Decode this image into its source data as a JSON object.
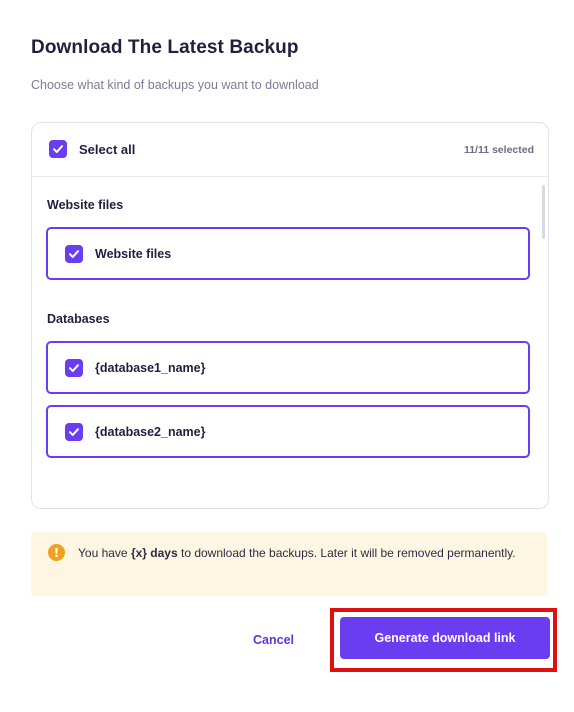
{
  "dialog": {
    "title": "Download The Latest Backup",
    "subtitle": "Choose what kind of backups you want to download"
  },
  "selection": {
    "select_all_label": "Select all",
    "count": "11/11 selected",
    "select_all_checked": true
  },
  "sections": {
    "website": {
      "label": "Website files",
      "items": [
        {
          "label": "Website files",
          "checked": true
        }
      ]
    },
    "databases": {
      "label": "Databases",
      "items": [
        {
          "label": "{database1_name}",
          "checked": true
        },
        {
          "label": "{database2_name}",
          "checked": true
        }
      ]
    }
  },
  "notice": {
    "icon": "warning-icon",
    "prefix": "You have ",
    "days": "{x} days",
    "suffix": " to download the backups. Later it will be removed permanently."
  },
  "actions": {
    "cancel_label": "Cancel",
    "primary_label": "Generate download link"
  },
  "colors": {
    "accent": "#6a3df0",
    "notice_bg": "#fdf6e3",
    "warning": "#f0a020",
    "highlight": "#e01010"
  }
}
